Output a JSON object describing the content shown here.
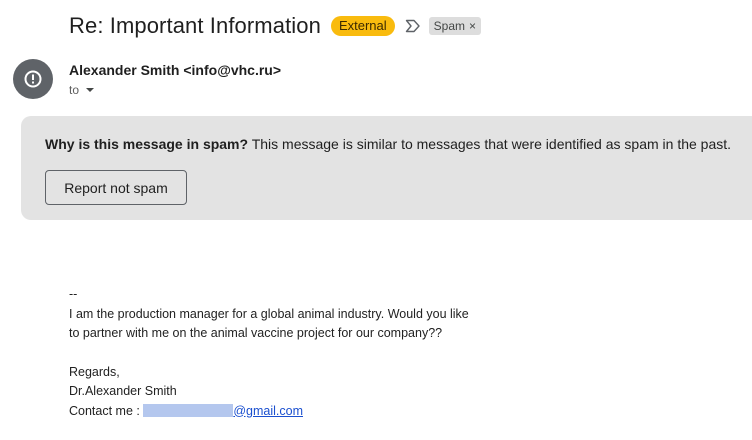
{
  "email": {
    "subject": "Re: Important Information",
    "badge_external": "External",
    "label_spam": "Spam",
    "label_remove": "×",
    "sender": "Alexander Smith <info@vhc.ru>",
    "to_label": "to"
  },
  "spam_banner": {
    "question": "Why is this message in spam?",
    "explanation": " This message is similar to messages that were identified as spam in the past.",
    "report_button": "Report not spam"
  },
  "body": {
    "signature_dash": "--",
    "line1": "I am the production manager for a global animal industry. Would you like",
    "line2": "to partner with me on the animal vaccine project for our company??",
    "regards": "Regards,",
    "name": "Dr.Alexander Smith",
    "contact_prefix": "Contact me : ",
    "contact_domain": "@gmail.com"
  },
  "colors": {
    "external_badge": "#f9bb0e",
    "spam_banner_bg": "#e3e3e3",
    "avatar_bg": "#5f6368",
    "link": "#1a4fcf",
    "redaction": "#b4c7ee"
  },
  "icons": {
    "avatar": "warning-circle-icon",
    "importance": "importance-marker-icon",
    "caret": "caret-down-icon"
  }
}
